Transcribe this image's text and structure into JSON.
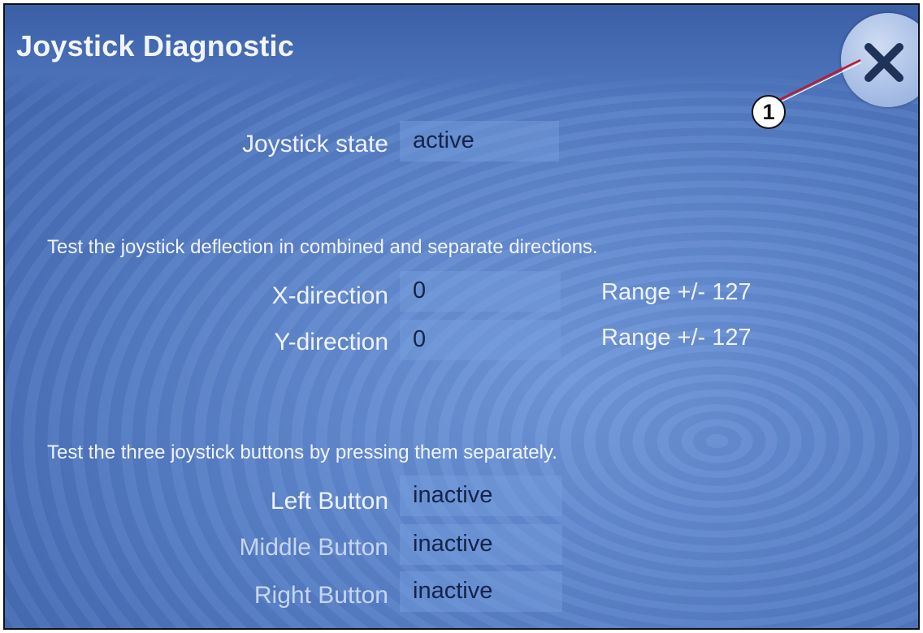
{
  "window": {
    "title": "Joystick Diagnostic",
    "close_label": "X",
    "callout_number": "1"
  },
  "state": {
    "label": "Joystick state",
    "value": "active"
  },
  "deflection": {
    "instructions": "Test the joystick deflection in combined and separate directions.",
    "x": {
      "label": "X-direction",
      "value": "0",
      "range": "Range +/- 127"
    },
    "y": {
      "label": "Y-direction",
      "value": "0",
      "range": "Range +/- 127"
    }
  },
  "buttons": {
    "instructions": "Test the three joystick buttons by pressing them separately.",
    "left": {
      "label": "Left Button",
      "value": "inactive"
    },
    "middle": {
      "label": "Middle Button",
      "value": "inactive"
    },
    "right": {
      "label": "Right Button",
      "value": "inactive"
    }
  },
  "icons": {
    "close": "close-icon"
  },
  "colors": {
    "background": "#5d85cc",
    "title_text": "#f1f5fb",
    "callout_line": "#c0182a"
  }
}
